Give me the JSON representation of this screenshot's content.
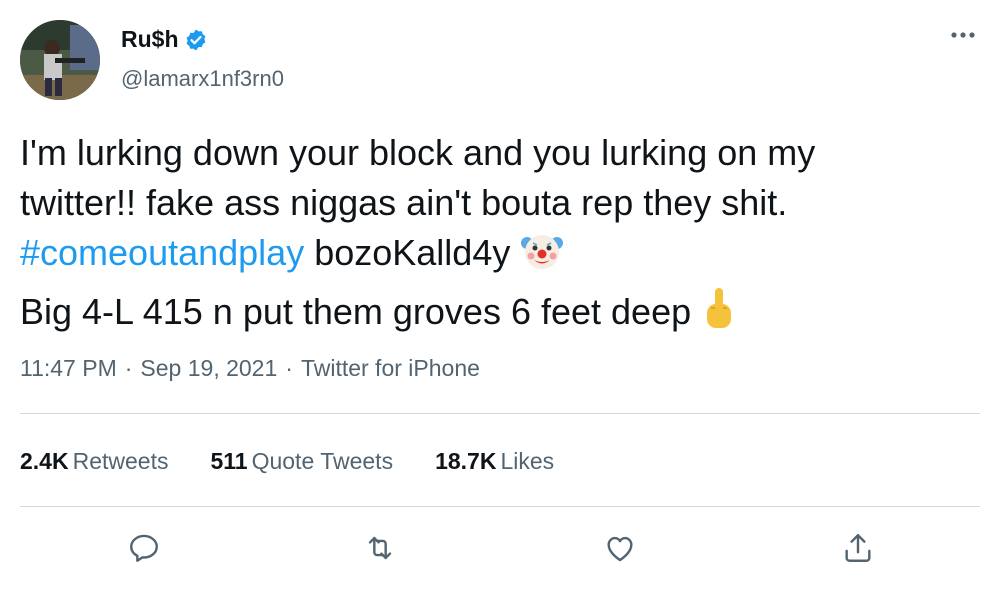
{
  "author": {
    "display_name": "Ru$h",
    "handle": "@lamarx1nf3rn0",
    "verified": true
  },
  "tweet": {
    "line1": "I'm lurking down your block and you lurking on my",
    "line2": "twitter!! fake ass niggas ain't bouta rep they shit.",
    "hashtag": "#comeoutandplay",
    "line3_rest": " bozoKalld4y",
    "line4": "Big 4-L 415 n put them groves 6 feet deep",
    "emoji_1": "clown-face-emoji",
    "emoji_2": "middle-finger-emoji"
  },
  "meta": {
    "time": "11:47 PM",
    "date": "Sep 19, 2021",
    "source": "Twitter for iPhone",
    "separator": "·"
  },
  "stats": {
    "retweets_count": "2.4K",
    "retweets_label": "Retweets",
    "quotes_count": "511",
    "quotes_label": "Quote Tweets",
    "likes_count": "18.7K",
    "likes_label": "Likes"
  },
  "icons": {
    "reply": "reply-icon",
    "retweet": "retweet-icon",
    "like": "like-icon",
    "share": "share-icon",
    "more": "more-icon"
  },
  "colors": {
    "accent": "#1d9bf0",
    "text": "#0f1419",
    "secondary": "#536471",
    "divider": "#cfd9de"
  }
}
